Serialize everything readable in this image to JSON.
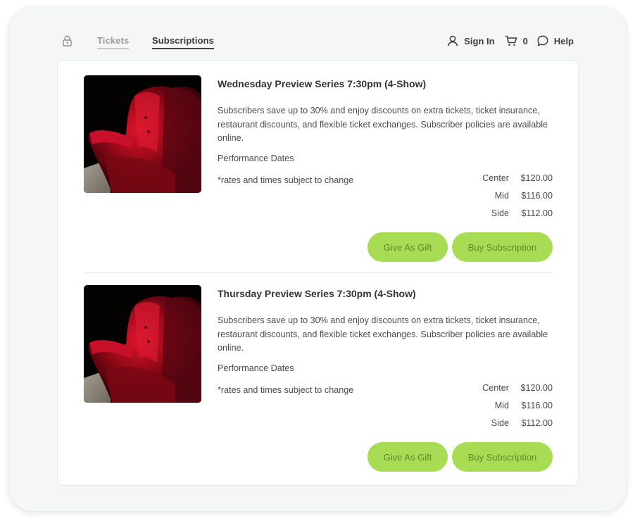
{
  "nav": {
    "lock_icon": "lock-icon",
    "tabs": [
      {
        "label": "Tickets",
        "active": false
      },
      {
        "label": "Subscriptions",
        "active": true
      }
    ],
    "sign_in": {
      "label": "Sign In",
      "icon": "user-icon"
    },
    "cart": {
      "count": "0",
      "icon": "cart-icon"
    },
    "help": {
      "label": "Help",
      "icon": "chat-bubble-icon"
    }
  },
  "colors": {
    "button_bg": "#a9dc55",
    "button_text": "#5f8a26",
    "active_tab": "#3a3a3a",
    "inactive_tab": "#9a9d9f"
  },
  "products": [
    {
      "image": "red-theater-seat",
      "title": "Wednesday Preview Series 7:30pm (4-Show)",
      "description": "Subscribers save up to 30% and enjoy discounts on extra tickets, ticket insurance, restaurant discounts, and flexible ticket exchanges. Subscriber policies are available online.",
      "performance_dates_label": "Performance Dates",
      "note": "*rates and times subject to change",
      "prices": [
        {
          "section": "Center",
          "price": "$120.00"
        },
        {
          "section": "Mid",
          "price": "$116.00"
        },
        {
          "section": "Side",
          "price": "$112.00"
        }
      ],
      "gift_label": "Give As Gift",
      "buy_label": "Buy Subscription"
    },
    {
      "image": "red-theater-seat",
      "title": "Thursday Preview Series 7:30pm (4-Show)",
      "description": "Subscribers save up to 30% and enjoy discounts on extra tickets, ticket insurance, restaurant discounts, and flexible ticket exchanges. Subscriber policies are available online.",
      "performance_dates_label": "Performance Dates",
      "note": "*rates and times subject to change",
      "prices": [
        {
          "section": "Center",
          "price": "$120.00"
        },
        {
          "section": "Mid",
          "price": "$116.00"
        },
        {
          "section": "Side",
          "price": "$112.00"
        }
      ],
      "gift_label": "Give As Gift",
      "buy_label": "Buy Subscription"
    }
  ]
}
